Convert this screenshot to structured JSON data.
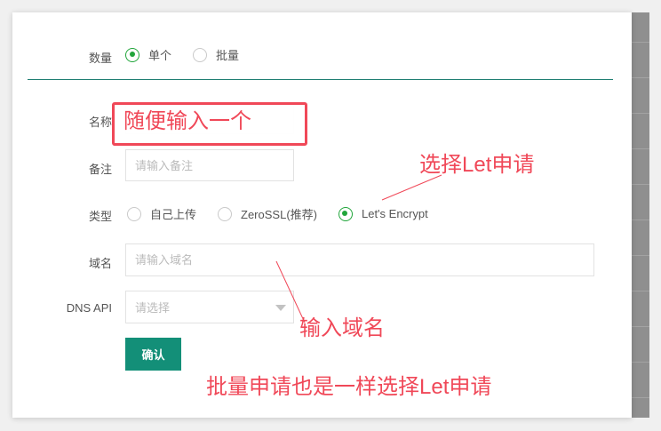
{
  "form": {
    "quantity": {
      "label": "数量",
      "options": [
        {
          "label": "单个",
          "selected": true
        },
        {
          "label": "批量",
          "selected": false
        }
      ]
    },
    "name": {
      "label": "名称",
      "value": ""
    },
    "remark": {
      "label": "备注",
      "placeholder": "请输入备注"
    },
    "type": {
      "label": "类型",
      "options": [
        {
          "label": "自己上传",
          "selected": false
        },
        {
          "label": "ZeroSSL(推荐)",
          "selected": false
        },
        {
          "label": "Let's Encrypt",
          "selected": true
        }
      ]
    },
    "domain": {
      "label": "域名",
      "placeholder": "请输入域名"
    },
    "dns_api": {
      "label": "DNS API",
      "placeholder": "请选择"
    },
    "confirm_label": "确认"
  },
  "annotations": {
    "name_hint": "随便输入一个",
    "type_hint": "选择Let申请",
    "domain_hint": "输入域名",
    "batch_hint": "批量申请也是一样选择Let申请"
  },
  "colors": {
    "accent_green": "#20a53a",
    "button_teal": "#138f78",
    "annotation_red": "#f04858"
  }
}
